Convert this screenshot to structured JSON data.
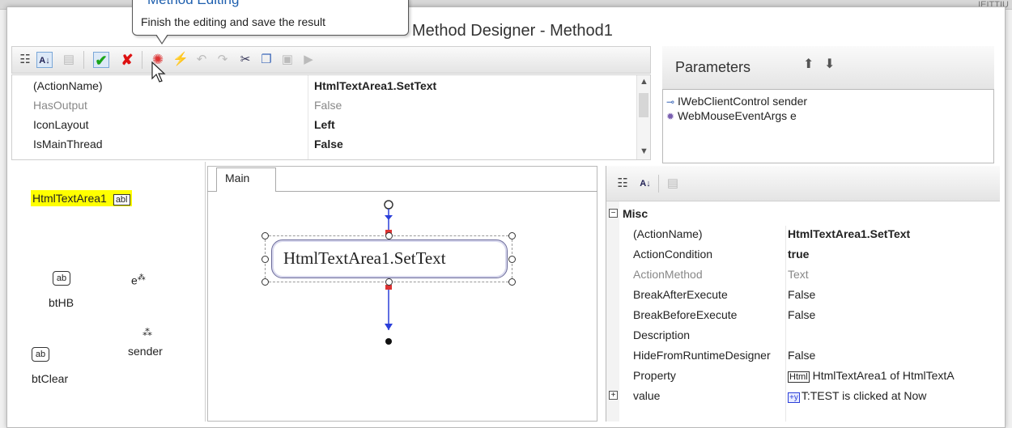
{
  "window": {
    "title": "Method Designer - Method1"
  },
  "tooltip": {
    "title": "Method Editing",
    "text": "Finish the editing and save the result"
  },
  "toolbar": {
    "icons": [
      "categorized-icon",
      "alphabetical-icon",
      "property-pages-icon",
      "ok-check-icon",
      "cancel-x-icon",
      "debug-icon",
      "magic-wand-icon",
      "undo-icon",
      "redo-icon",
      "cut-icon",
      "copy-icon",
      "paste-icon",
      "run-icon"
    ]
  },
  "method_props": [
    {
      "name": "(ActionName)",
      "value": "HtmlTextArea1.SetText",
      "bold": true,
      "dim": false
    },
    {
      "name": "HasOutput",
      "value": "False",
      "bold": false,
      "dim": true
    },
    {
      "name": "IconLayout",
      "value": "Left",
      "bold": true,
      "dim": false
    },
    {
      "name": "IsMainThread",
      "value": "False",
      "bold": true,
      "dim": false
    }
  ],
  "parameters": {
    "title": "Parameters",
    "items": [
      {
        "icon": "interface-icon",
        "label": "IWebClientControl sender"
      },
      {
        "icon": "class-icon",
        "label": "WebMouseEventArgs e"
      }
    ]
  },
  "components": {
    "html_text_area": "HtmlTextArea1",
    "html_text_area_badge": "abl",
    "bthb": "btHB",
    "bthb_icon": "ab",
    "e": "e",
    "sender": "sender",
    "btclear": "btClear",
    "btclear_icon": "ab"
  },
  "designer": {
    "tab": "Main",
    "node_label": "HtmlTextArea1.SetText"
  },
  "property_grid": {
    "category": "Misc",
    "rows": [
      {
        "name": "(ActionName)",
        "value": "HtmlTextArea1.SetText",
        "bold": true,
        "dim": false
      },
      {
        "name": "ActionCondition",
        "value": "true",
        "bold": true,
        "dim": false
      },
      {
        "name": "ActionMethod",
        "value": "Text",
        "bold": false,
        "dim": true
      },
      {
        "name": "BreakAfterExecute",
        "value": "False",
        "bold": false,
        "dim": false
      },
      {
        "name": "BreakBeforeExecute",
        "value": "False",
        "bold": false,
        "dim": false
      },
      {
        "name": "Description",
        "value": "",
        "bold": false,
        "dim": false
      },
      {
        "name": "HideFromRuntimeDesigner",
        "value": "False",
        "bold": false,
        "dim": false
      },
      {
        "name": "Property",
        "value": "HtmlTextArea1 of HtmlTextA",
        "value_badge": "Html",
        "bold": false,
        "dim": false
      },
      {
        "name": "value",
        "value": "T:TEST is clicked at Now",
        "value_badge": "+y",
        "bold": false,
        "dim": false
      }
    ]
  },
  "topstrip": {
    "right_text": "IEITTIU"
  }
}
